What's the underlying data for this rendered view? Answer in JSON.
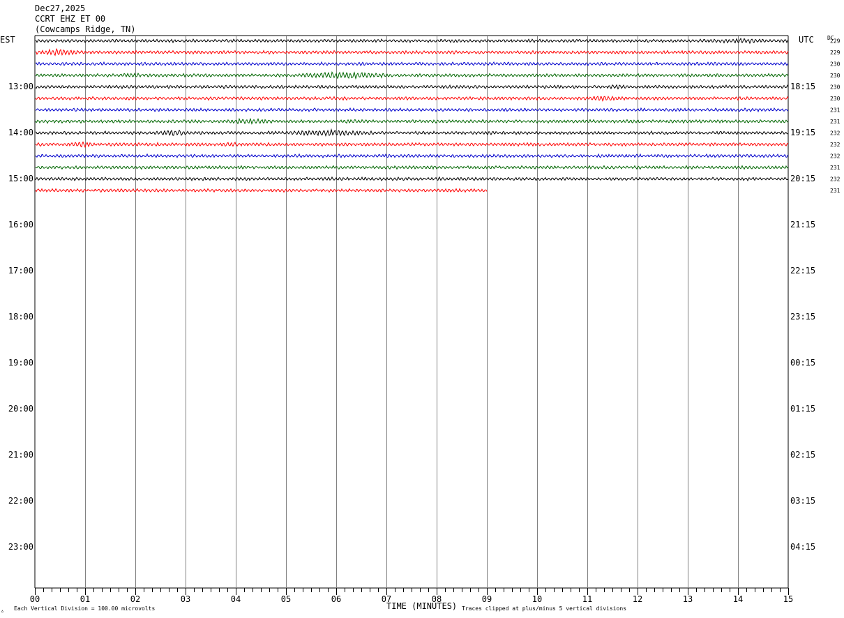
{
  "header": {
    "date": "Dec27,2025",
    "station": "CCRT EHZ ET 00",
    "location": "(Cowcamps Ridge, TN)"
  },
  "left_zone": "EST",
  "right_zone": "UTC",
  "dc_label": "DC",
  "footer": {
    "left_note": "Each Vertical Division =  100.00 microvolts",
    "right_note": "Traces clipped at plus/minus 5 vertical divisions",
    "corner_mark": "▵"
  },
  "colors": {
    "black": "#000000",
    "red": "#ff0000",
    "blue": "#0000cc",
    "green": "#006600",
    "grid": "#808080"
  },
  "chart_data": {
    "type": "line",
    "title": "CCRT EHZ ET 00",
    "xlabel": "TIME (MINUTES)",
    "xlim": [
      0,
      15
    ],
    "x_ticks": [
      "00",
      "01",
      "02",
      "03",
      "04",
      "05",
      "06",
      "07",
      "08",
      "09",
      "10",
      "11",
      "12",
      "13",
      "14",
      "15"
    ],
    "left_hour_labels": [
      "13:00",
      "14:00",
      "15:00",
      "16:00",
      "17:00",
      "18:00",
      "19:00",
      "20:00",
      "21:00",
      "22:00",
      "23:00"
    ],
    "right_hour_labels": [
      "18:15",
      "19:15",
      "20:15",
      "21:15",
      "22:15",
      "23:15",
      "00:15",
      "01:15",
      "02:15",
      "03:15",
      "04:15"
    ],
    "series": [
      {
        "color": "#000000",
        "dc": "229",
        "end_minute": 15,
        "bursts": [
          [
            13.2,
            14.8,
            1.8
          ]
        ]
      },
      {
        "color": "#ff0000",
        "dc": "229",
        "end_minute": 15,
        "bursts": [
          [
            0.0,
            0.9,
            2.4
          ],
          [
            5.8,
            6.1,
            1.5
          ]
        ]
      },
      {
        "color": "#0000cc",
        "dc": "230",
        "end_minute": 15,
        "bursts": []
      },
      {
        "color": "#006600",
        "dc": "230",
        "end_minute": 15,
        "bursts": [
          [
            1.6,
            2.2,
            1.8
          ],
          [
            5.3,
            7.1,
            2.6
          ]
        ]
      },
      {
        "color": "#000000",
        "dc": "230",
        "end_minute": 15,
        "bursts": [
          [
            11.3,
            11.9,
            1.6
          ]
        ]
      },
      {
        "color": "#ff0000",
        "dc": "230",
        "end_minute": 15,
        "bursts": [
          [
            4.0,
            4.3,
            1.4
          ],
          [
            10.9,
            11.7,
            2.0
          ]
        ]
      },
      {
        "color": "#0000cc",
        "dc": "231",
        "end_minute": 15,
        "bursts": [
          [
            4.3,
            4.6,
            1.3
          ]
        ]
      },
      {
        "color": "#006600",
        "dc": "231",
        "end_minute": 15,
        "bursts": [
          [
            3.6,
            4.9,
            2.0
          ],
          [
            6.0,
            6.6,
            1.6
          ]
        ]
      },
      {
        "color": "#000000",
        "dc": "232",
        "end_minute": 15,
        "bursts": [
          [
            2.4,
            3.1,
            2.2
          ],
          [
            5.1,
            6.7,
            2.4
          ]
        ]
      },
      {
        "color": "#ff0000",
        "dc": "232",
        "end_minute": 15,
        "bursts": [
          [
            0.7,
            1.2,
            2.2
          ],
          [
            3.6,
            4.2,
            1.6
          ]
        ]
      },
      {
        "color": "#0000cc",
        "dc": "232",
        "end_minute": 15,
        "bursts": []
      },
      {
        "color": "#006600",
        "dc": "231",
        "end_minute": 15,
        "bursts": []
      },
      {
        "color": "#000000",
        "dc": "232",
        "end_minute": 15,
        "bursts": [
          [
            9.0,
            9.2,
            1.3
          ]
        ]
      },
      {
        "color": "#ff0000",
        "dc": "231",
        "end_minute": 9,
        "bursts": []
      }
    ]
  }
}
